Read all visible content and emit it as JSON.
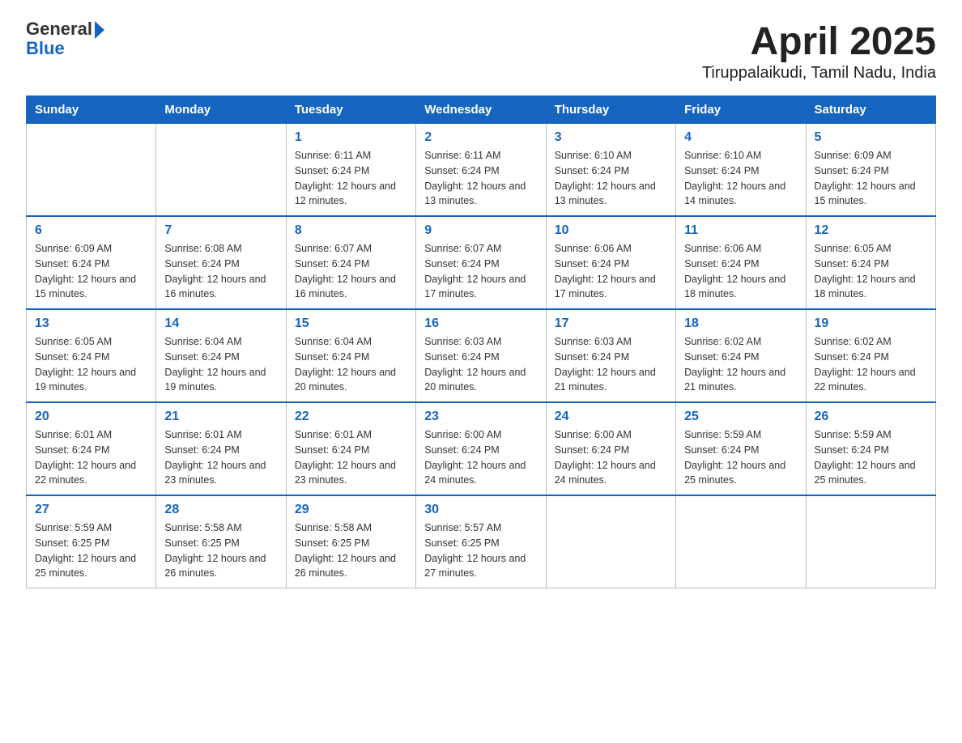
{
  "logo": {
    "general": "General",
    "blue": "Blue"
  },
  "title": "April 2025",
  "subtitle": "Tiruppalaikudi, Tamil Nadu, India",
  "days_of_week": [
    "Sunday",
    "Monday",
    "Tuesday",
    "Wednesday",
    "Thursday",
    "Friday",
    "Saturday"
  ],
  "weeks": [
    [
      {
        "day": "",
        "sunrise": "",
        "sunset": "",
        "daylight": ""
      },
      {
        "day": "",
        "sunrise": "",
        "sunset": "",
        "daylight": ""
      },
      {
        "day": "1",
        "sunrise": "Sunrise: 6:11 AM",
        "sunset": "Sunset: 6:24 PM",
        "daylight": "Daylight: 12 hours and 12 minutes."
      },
      {
        "day": "2",
        "sunrise": "Sunrise: 6:11 AM",
        "sunset": "Sunset: 6:24 PM",
        "daylight": "Daylight: 12 hours and 13 minutes."
      },
      {
        "day": "3",
        "sunrise": "Sunrise: 6:10 AM",
        "sunset": "Sunset: 6:24 PM",
        "daylight": "Daylight: 12 hours and 13 minutes."
      },
      {
        "day": "4",
        "sunrise": "Sunrise: 6:10 AM",
        "sunset": "Sunset: 6:24 PM",
        "daylight": "Daylight: 12 hours and 14 minutes."
      },
      {
        "day": "5",
        "sunrise": "Sunrise: 6:09 AM",
        "sunset": "Sunset: 6:24 PM",
        "daylight": "Daylight: 12 hours and 15 minutes."
      }
    ],
    [
      {
        "day": "6",
        "sunrise": "Sunrise: 6:09 AM",
        "sunset": "Sunset: 6:24 PM",
        "daylight": "Daylight: 12 hours and 15 minutes."
      },
      {
        "day": "7",
        "sunrise": "Sunrise: 6:08 AM",
        "sunset": "Sunset: 6:24 PM",
        "daylight": "Daylight: 12 hours and 16 minutes."
      },
      {
        "day": "8",
        "sunrise": "Sunrise: 6:07 AM",
        "sunset": "Sunset: 6:24 PM",
        "daylight": "Daylight: 12 hours and 16 minutes."
      },
      {
        "day": "9",
        "sunrise": "Sunrise: 6:07 AM",
        "sunset": "Sunset: 6:24 PM",
        "daylight": "Daylight: 12 hours and 17 minutes."
      },
      {
        "day": "10",
        "sunrise": "Sunrise: 6:06 AM",
        "sunset": "Sunset: 6:24 PM",
        "daylight": "Daylight: 12 hours and 17 minutes."
      },
      {
        "day": "11",
        "sunrise": "Sunrise: 6:06 AM",
        "sunset": "Sunset: 6:24 PM",
        "daylight": "Daylight: 12 hours and 18 minutes."
      },
      {
        "day": "12",
        "sunrise": "Sunrise: 6:05 AM",
        "sunset": "Sunset: 6:24 PM",
        "daylight": "Daylight: 12 hours and 18 minutes."
      }
    ],
    [
      {
        "day": "13",
        "sunrise": "Sunrise: 6:05 AM",
        "sunset": "Sunset: 6:24 PM",
        "daylight": "Daylight: 12 hours and 19 minutes."
      },
      {
        "day": "14",
        "sunrise": "Sunrise: 6:04 AM",
        "sunset": "Sunset: 6:24 PM",
        "daylight": "Daylight: 12 hours and 19 minutes."
      },
      {
        "day": "15",
        "sunrise": "Sunrise: 6:04 AM",
        "sunset": "Sunset: 6:24 PM",
        "daylight": "Daylight: 12 hours and 20 minutes."
      },
      {
        "day": "16",
        "sunrise": "Sunrise: 6:03 AM",
        "sunset": "Sunset: 6:24 PM",
        "daylight": "Daylight: 12 hours and 20 minutes."
      },
      {
        "day": "17",
        "sunrise": "Sunrise: 6:03 AM",
        "sunset": "Sunset: 6:24 PM",
        "daylight": "Daylight: 12 hours and 21 minutes."
      },
      {
        "day": "18",
        "sunrise": "Sunrise: 6:02 AM",
        "sunset": "Sunset: 6:24 PM",
        "daylight": "Daylight: 12 hours and 21 minutes."
      },
      {
        "day": "19",
        "sunrise": "Sunrise: 6:02 AM",
        "sunset": "Sunset: 6:24 PM",
        "daylight": "Daylight: 12 hours and 22 minutes."
      }
    ],
    [
      {
        "day": "20",
        "sunrise": "Sunrise: 6:01 AM",
        "sunset": "Sunset: 6:24 PM",
        "daylight": "Daylight: 12 hours and 22 minutes."
      },
      {
        "day": "21",
        "sunrise": "Sunrise: 6:01 AM",
        "sunset": "Sunset: 6:24 PM",
        "daylight": "Daylight: 12 hours and 23 minutes."
      },
      {
        "day": "22",
        "sunrise": "Sunrise: 6:01 AM",
        "sunset": "Sunset: 6:24 PM",
        "daylight": "Daylight: 12 hours and 23 minutes."
      },
      {
        "day": "23",
        "sunrise": "Sunrise: 6:00 AM",
        "sunset": "Sunset: 6:24 PM",
        "daylight": "Daylight: 12 hours and 24 minutes."
      },
      {
        "day": "24",
        "sunrise": "Sunrise: 6:00 AM",
        "sunset": "Sunset: 6:24 PM",
        "daylight": "Daylight: 12 hours and 24 minutes."
      },
      {
        "day": "25",
        "sunrise": "Sunrise: 5:59 AM",
        "sunset": "Sunset: 6:24 PM",
        "daylight": "Daylight: 12 hours and 25 minutes."
      },
      {
        "day": "26",
        "sunrise": "Sunrise: 5:59 AM",
        "sunset": "Sunset: 6:24 PM",
        "daylight": "Daylight: 12 hours and 25 minutes."
      }
    ],
    [
      {
        "day": "27",
        "sunrise": "Sunrise: 5:59 AM",
        "sunset": "Sunset: 6:25 PM",
        "daylight": "Daylight: 12 hours and 25 minutes."
      },
      {
        "day": "28",
        "sunrise": "Sunrise: 5:58 AM",
        "sunset": "Sunset: 6:25 PM",
        "daylight": "Daylight: 12 hours and 26 minutes."
      },
      {
        "day": "29",
        "sunrise": "Sunrise: 5:58 AM",
        "sunset": "Sunset: 6:25 PM",
        "daylight": "Daylight: 12 hours and 26 minutes."
      },
      {
        "day": "30",
        "sunrise": "Sunrise: 5:57 AM",
        "sunset": "Sunset: 6:25 PM",
        "daylight": "Daylight: 12 hours and 27 minutes."
      },
      {
        "day": "",
        "sunrise": "",
        "sunset": "",
        "daylight": ""
      },
      {
        "day": "",
        "sunrise": "",
        "sunset": "",
        "daylight": ""
      },
      {
        "day": "",
        "sunrise": "",
        "sunset": "",
        "daylight": ""
      }
    ]
  ]
}
